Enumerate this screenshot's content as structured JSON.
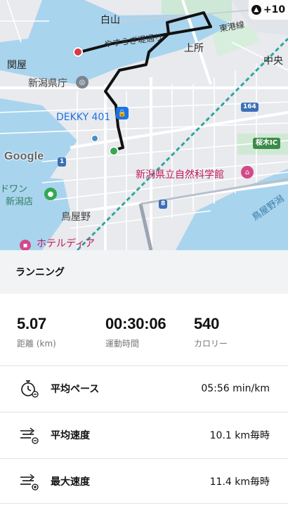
{
  "map": {
    "labels": {
      "hakusan": "白山",
      "yasuragi": "やすらぎ堤通り",
      "higashiko": "東港線",
      "kamitokoro": "上所",
      "sekiya": "関屋",
      "chuo": "中央",
      "prefecture_office": "新潟県庁",
      "dekky": "DEKKY 401",
      "museum": "新潟県立自然科学館",
      "store_line1": "ドワン",
      "store_line2": "新潟店",
      "toriyano": "鳥屋野",
      "hotel": "ホテルディア",
      "toriyano_lagoon": "鳥屋野潟",
      "sakuragi_ic": "桜木IC",
      "route_164": "164",
      "route_1": "1",
      "route_8": "8"
    },
    "google_logo": "Google",
    "badge": "+10",
    "route_color": "#111111",
    "start_color": "#34a853",
    "end_color": "#d93849"
  },
  "activity": {
    "title": "ランニング"
  },
  "stats": {
    "distance": {
      "value": "5.07",
      "label": "距離 (km)"
    },
    "duration": {
      "value": "00:30:06",
      "label": "運動時間"
    },
    "calories": {
      "value": "540",
      "label": "カロリー"
    }
  },
  "rows": [
    {
      "name": "平均ペース",
      "value": "05:56 min/km",
      "icon": "stopwatch-icon"
    },
    {
      "name": "平均速度",
      "value": "10.1 km毎時",
      "icon": "speed-lines-icon"
    },
    {
      "name": "最大速度",
      "value": "11.4 km毎時",
      "icon": "max-speed-icon"
    }
  ]
}
